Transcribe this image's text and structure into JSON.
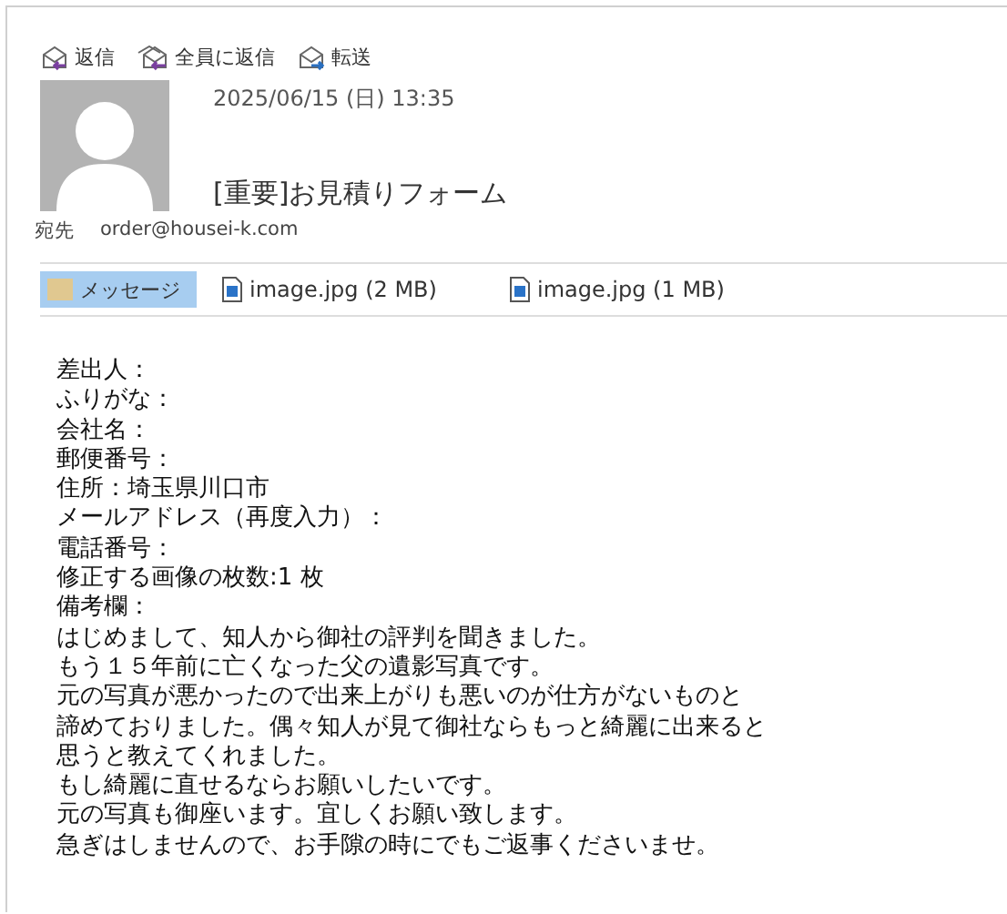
{
  "toolbar": [
    {
      "kind": "reply",
      "label": "返信"
    },
    {
      "kind": "reply_all",
      "label": "全員に返信"
    },
    {
      "kind": "forward",
      "label": "転送"
    }
  ],
  "header": {
    "date": "2025/06/15 (日) 13:35",
    "subject": "[重要]お見積りフォーム",
    "to_label": "宛先",
    "to": "order@housei-k.com"
  },
  "attachments": [
    {
      "kind": "message",
      "label": "メッセージ",
      "selected": true
    },
    {
      "kind": "file",
      "label": "image.jpg (2 MB)",
      "selected": false
    },
    {
      "kind": "file",
      "label": "image.jpg (1 MB)",
      "selected": false
    }
  ],
  "body": [
    "差出人：",
    "ふりがな：",
    "会社名：",
    "郵便番号：",
    "住所：埼玉県川口市",
    "メールアドレス（再度入力）：",
    "電話番号：",
    "修正する画像の枚数:1 枚",
    "備考欄：",
    "はじめまして、知人から御社の評判を聞きました。",
    "もう１５年前に亡くなった父の遺影写真です。",
    "元の写真が悪かったので出来上がりも悪いのが仕方がないものと",
    "諦めておりました。偶々知人が見て御社ならもっと綺麗に出来ると",
    "思うと教えてくれました。",
    "もし綺麗に直せるならお願いしたいです。",
    "元の写真も御座います。宜しくお願い致します。",
    "急ぎはしませんので、お手隙の時にでもご返事くださいませ。"
  ]
}
